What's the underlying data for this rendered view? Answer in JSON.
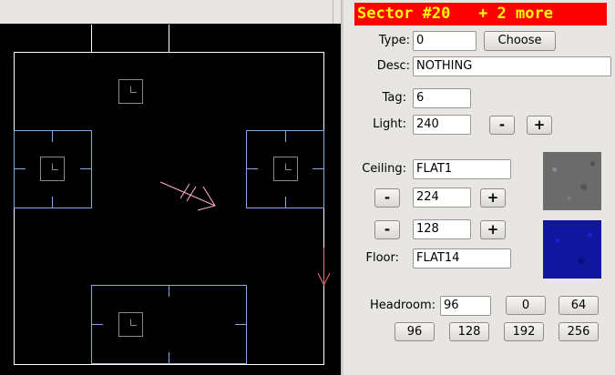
{
  "panel": {
    "title": "Sector #20   + 2 more",
    "type": {
      "label": "Type:",
      "value": "0",
      "choose_label": "Choose"
    },
    "desc": {
      "label": "Desc:",
      "value": "NOTHING"
    },
    "tag": {
      "label": "Tag:",
      "value": "6"
    },
    "light": {
      "label": "Light:",
      "value": "240",
      "minus": "-",
      "plus": "+"
    },
    "ceiling": {
      "label": "Ceiling:",
      "texture": "FLAT1",
      "height": "224",
      "minus": "-",
      "plus": "+"
    },
    "floor": {
      "label": "Floor:",
      "texture": "FLAT14",
      "height": "128",
      "minus": "-",
      "plus": "+"
    },
    "headroom": {
      "label": "Headroom:",
      "value": "96",
      "presets_row1": [
        "0",
        "64"
      ],
      "presets_row2": [
        "96",
        "128",
        "192",
        "256"
      ]
    }
  },
  "colors": {
    "title_bg": "#ff0000",
    "title_text": "#ffff00",
    "map_bg": "#000000",
    "wall_white": "#ffffff",
    "wall_selected": "#7fa8e8",
    "wall_gray": "#8a8a8a",
    "thing_arrow": "#ffb0d0",
    "red_marker": "#ff6b6b"
  },
  "icons": {
    "thing": "player-start-arrow-icon",
    "marker": "red-down-arrow-icon"
  }
}
